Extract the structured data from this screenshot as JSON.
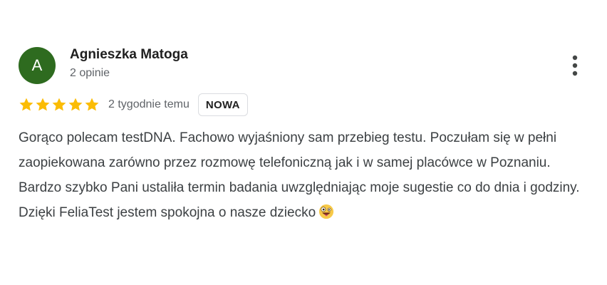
{
  "review": {
    "author": {
      "initial": "A",
      "name": "Agnieszka Matoga",
      "reviews_count": "2 opinie",
      "avatar_color": "#2e6b1f"
    },
    "rating": 5,
    "rating_max": 5,
    "star_color": "#fbbc04",
    "time": "2 tygodnie temu",
    "badge": "NOWA",
    "text": "Gorąco polecam testDNA. Fachowo wyjaśniony sam przebieg testu. Poczułam się w pełni zaopiekowana zarówno przez rozmowę telefoniczną jak i w samej placówce w Poznaniu. Bardzo szybko Pani ustaliła termin badania uwzględniając moje sugestie co do dnia i godziny. Dzięki FeliaTest jestem spokojna o nasze dziecko",
    "emoji_icon": "zany-face-emoji",
    "menu_icon": "more-vert-icon"
  }
}
